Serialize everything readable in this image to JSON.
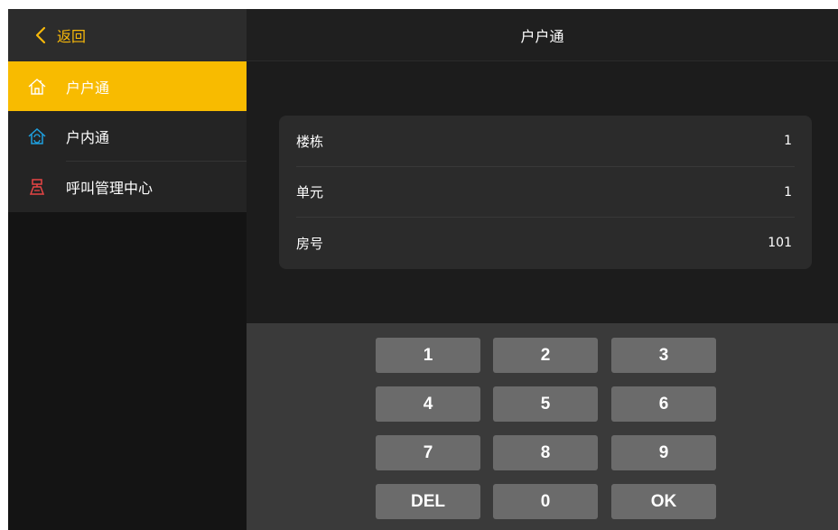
{
  "sidebar": {
    "back_label": "返回",
    "items": [
      {
        "label": "户户通",
        "icon": "house-outline-icon",
        "active": true
      },
      {
        "label": "户内通",
        "icon": "house-arrows-icon",
        "active": false
      },
      {
        "label": "呼叫管理中心",
        "icon": "management-center-icon",
        "active": false
      }
    ]
  },
  "header": {
    "title": "户户通"
  },
  "form": {
    "rows": [
      {
        "label": "楼栋",
        "value": "1"
      },
      {
        "label": "单元",
        "value": "1"
      },
      {
        "label": "房号",
        "value": "101"
      }
    ]
  },
  "keypad": {
    "keys": [
      "1",
      "2",
      "3",
      "4",
      "5",
      "6",
      "7",
      "8",
      "9",
      "DEL",
      "0",
      "OK"
    ]
  },
  "colors": {
    "accent": "#f8bb00",
    "back_text": "#f7b80a",
    "icon_blue": "#1ea0e0",
    "icon_red": "#e64545"
  }
}
